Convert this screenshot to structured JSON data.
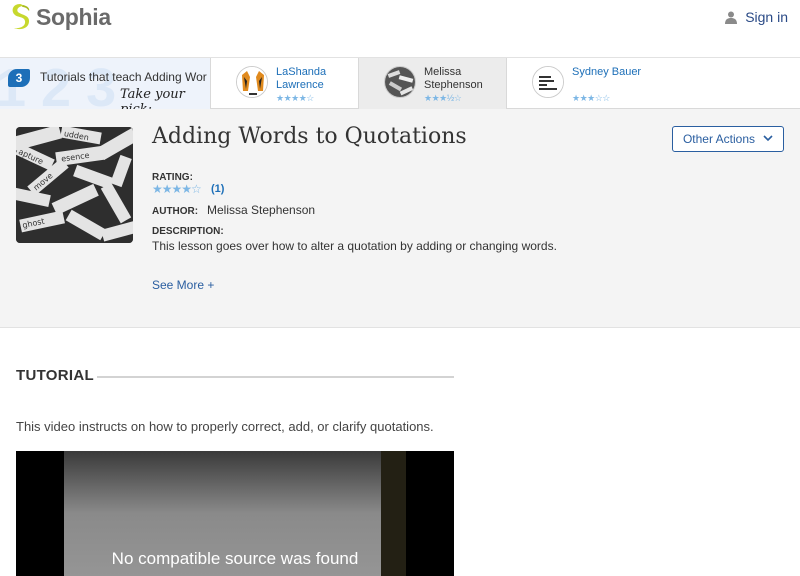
{
  "header": {
    "logo_text": "Sophia",
    "signin_label": "Sign in"
  },
  "tutorials_strip": {
    "count": "3",
    "intro_text": "Tutorials that teach Adding Wor",
    "pick_text": "Take your pick:",
    "items": [
      {
        "name": "LaShanda Lawrence",
        "stars": "★★★★☆",
        "rating": 4,
        "active": false
      },
      {
        "name": "Melissa Stephenson",
        "stars": "★★★½☆",
        "rating": 3.5,
        "active": true
      },
      {
        "name": "Sydney Bauer",
        "stars": "★★★☆☆",
        "rating": 3,
        "active": false
      }
    ]
  },
  "lesson": {
    "title": "Adding Words to Quotations",
    "other_actions_label": "Other Actions",
    "rating_label": "RATING:",
    "rating_stars": "★★★★☆",
    "rating_count": "(1)",
    "author_label": "AUTHOR:",
    "author": "Melissa Stephenson",
    "description_label": "DESCRIPTION:",
    "description": "This lesson goes over how to alter a quotation by adding or changing words.",
    "see_more_label": "See More +"
  },
  "tutorial": {
    "heading": "TUTORIAL",
    "description": "This video instructs on how to properly correct, add, or clarify quotations.",
    "video_message": "No compatible source was found"
  },
  "colors": {
    "brand_green": "#c7d82e",
    "link_blue": "#1d6fb8",
    "button_blue": "#2a5ea0",
    "star_blue": "#7db7e5"
  }
}
